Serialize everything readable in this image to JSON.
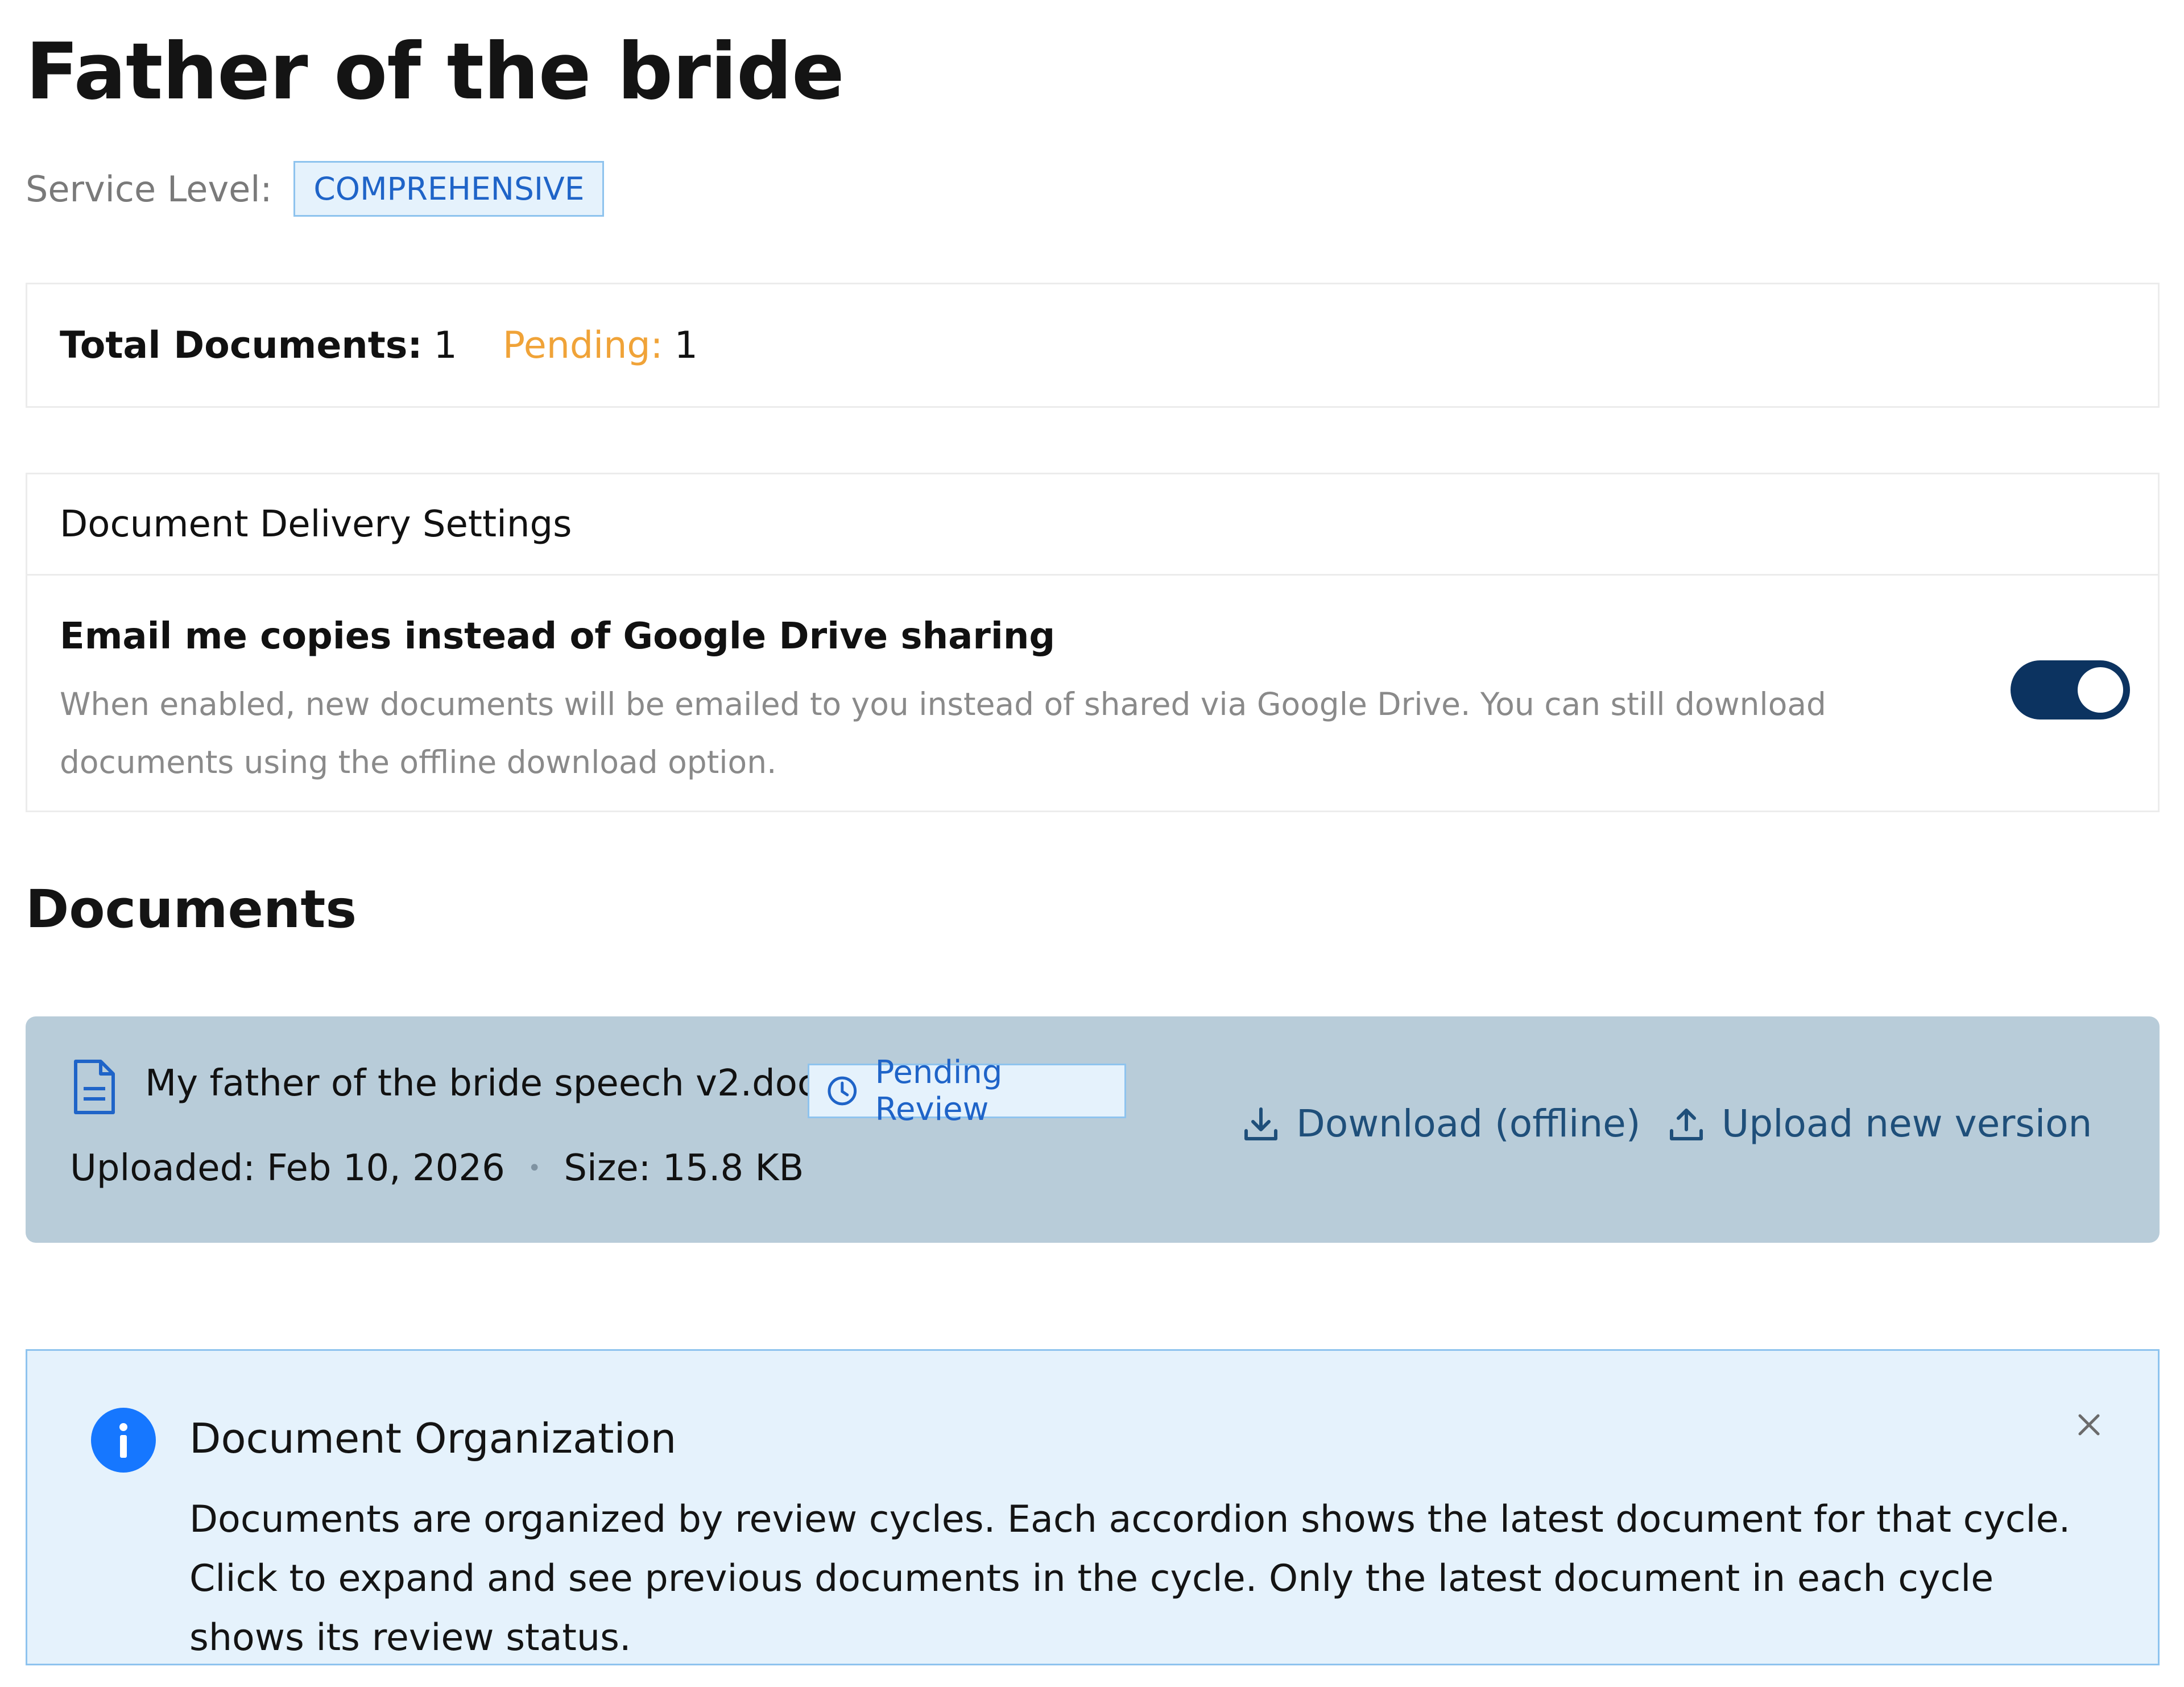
{
  "page": {
    "title": "Father of the bride",
    "service_level_label": "Service Level:",
    "service_level_value": "COMPREHENSIVE"
  },
  "stats": {
    "total_label": "Total Documents:",
    "total_value": "1",
    "pending_label": "Pending:",
    "pending_value": "1"
  },
  "delivery_settings": {
    "heading": "Document Delivery Settings",
    "email_option_title": "Email me copies instead of Google Drive sharing",
    "email_option_description": "When enabled, new documents will be emailed to you instead of shared via Google Drive. You can still download documents using the offline download option.",
    "email_option_enabled": true,
    "toggle_color": "#0c3360"
  },
  "documents": {
    "heading": "Documents",
    "items": [
      {
        "icon": "document-icon",
        "name": "My father of the bride speech v2.docx",
        "status": "Pending Review",
        "status_icon": "clock-icon",
        "uploaded": "Uploaded: Feb 10, 2026",
        "separator": "•",
        "size": "Size: 15.8 KB",
        "download_label": "Download (offline)",
        "download_icon": "download-icon",
        "upload_label": "Upload new version",
        "upload_icon": "upload-icon"
      }
    ]
  },
  "info_alert": {
    "icon": "info-icon",
    "title": "Document Organization",
    "text": "Documents are organized by review cycles. Each accordion shows the latest document for that cycle. Click to expand and see previous documents in the cycle. Only the latest document in each cycle shows its review status.",
    "close_icon": "close-icon"
  },
  "colors": {
    "accent_blue": "#1f64c8",
    "pending_orange": "#f0a338",
    "doc_card_bg": "#b8ccd9",
    "info_bg": "#e5f2fc"
  }
}
